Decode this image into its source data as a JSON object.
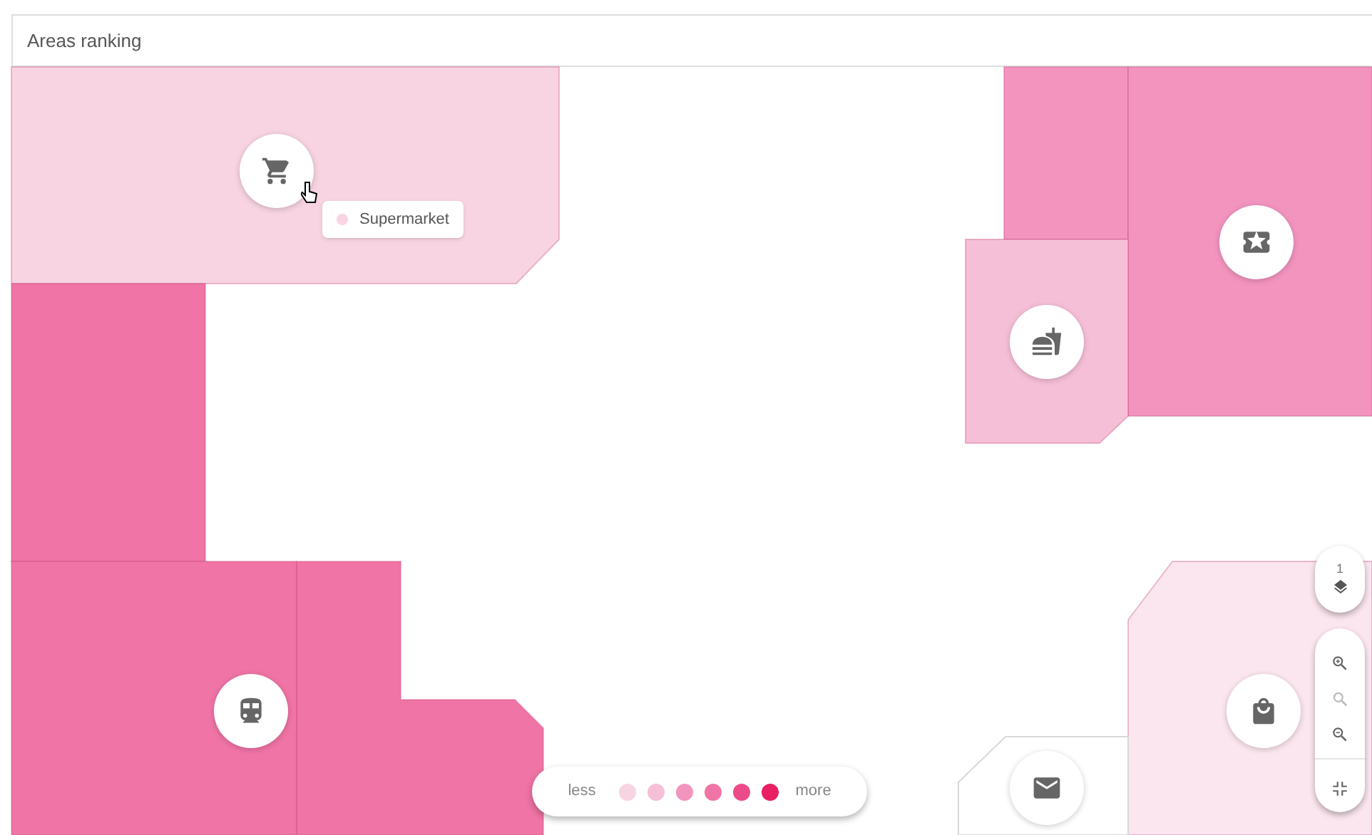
{
  "panel": {
    "title": "Areas ranking"
  },
  "areas": [
    {
      "color": "#f8d4e2"
    },
    {
      "color": "#f074a6"
    },
    {
      "color": "#f074a6"
    },
    {
      "color": "#f074a6"
    },
    {
      "color": "#f394bf"
    },
    {
      "color": "#f394bf"
    },
    {
      "color": "#f6bfd8"
    },
    {
      "color": "#fbe5ee"
    },
    {
      "color": "#ffffff"
    }
  ],
  "tooltip": {
    "label": "Supermarket",
    "color": "#f8d4e2"
  },
  "floor_control": {
    "label": "1"
  },
  "zoom_controls": [
    {
      "kind": "zoom-in",
      "disabled": false
    },
    {
      "kind": "reset",
      "disabled": true
    },
    {
      "kind": "zoom-out",
      "disabled": false
    },
    {
      "kind": "fit",
      "disabled": false
    }
  ],
  "legend": {
    "low_label": "less",
    "high_label": "more",
    "steps": [
      {
        "color": "#f8d4e2"
      },
      {
        "color": "#f6bfd8"
      },
      {
        "color": "#f394bf"
      },
      {
        "color": "#f074a6"
      },
      {
        "color": "#ec4b8a"
      },
      {
        "color": "#e91e63"
      }
    ]
  }
}
